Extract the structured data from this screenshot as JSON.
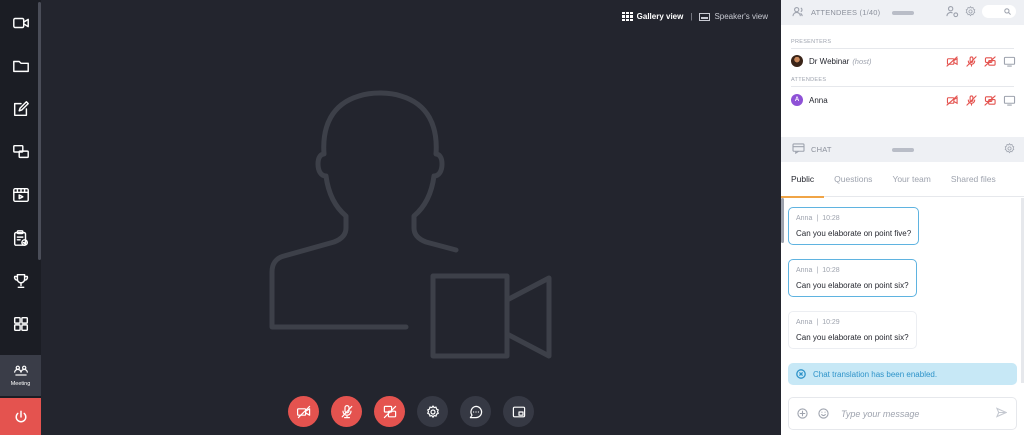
{
  "sidebar": {
    "items": [
      {
        "icon": "camera-icon"
      },
      {
        "icon": "folder-icon"
      },
      {
        "icon": "edit-icon"
      },
      {
        "icon": "screens-icon"
      },
      {
        "icon": "media-icon"
      },
      {
        "icon": "clipboard-check-icon"
      },
      {
        "icon": "trophy-icon"
      },
      {
        "icon": "apps-icon"
      }
    ],
    "meeting_label": "Meeting",
    "power_icon": "power-icon"
  },
  "stage": {
    "gallery_view_label": "Gallery view",
    "separator": "|",
    "speaker_view_label": "Speaker's view"
  },
  "controls": [
    {
      "icon": "camera-off-icon",
      "color": "#e4534f"
    },
    {
      "icon": "mic-off-icon",
      "color": "#e4534f"
    },
    {
      "icon": "screenshare-off-icon",
      "color": "#e4534f"
    },
    {
      "icon": "settings-icon",
      "color": "#363944"
    },
    {
      "icon": "chat-icon",
      "color": "#363944"
    },
    {
      "icon": "picture-in-picture-icon",
      "color": "#363944"
    }
  ],
  "attendees": {
    "title": "ATTENDEES (1/40)",
    "presenters_label": "PRESENTERS",
    "attendees_label": "ATTENDEES",
    "presenter": {
      "name": "Dr Webinar",
      "role": "(host)"
    },
    "attendee": {
      "name": "Anna",
      "initial": "A"
    }
  },
  "chat": {
    "title": "CHAT",
    "tabs": [
      "Public",
      "Questions",
      "Your team",
      "Shared files"
    ],
    "messages": [
      {
        "author": "Anna",
        "sep": "|",
        "time": "10:28",
        "text": "Can you elaborate on point five?"
      },
      {
        "author": "Anna",
        "sep": "|",
        "time": "10:28",
        "text": "Can you elaborate on point six?"
      },
      {
        "author": "Anna",
        "sep": "|",
        "time": "10:29",
        "text": "Can you elaborate on point six?"
      }
    ],
    "notice": "Chat translation has been enabled.",
    "input_placeholder": "Type your message"
  },
  "colors": {
    "accent_red": "#e4534f",
    "tab_underline": "#f0a446",
    "highlight_border": "#5fb3e0",
    "notice_bg": "#c7e8f6"
  }
}
